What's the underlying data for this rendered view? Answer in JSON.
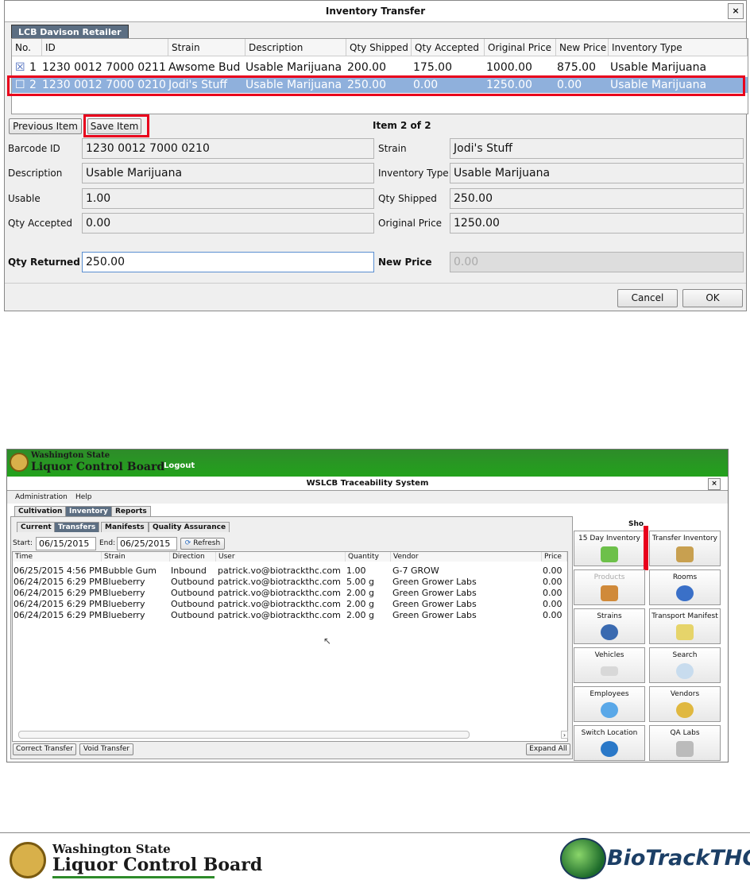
{
  "dialog": {
    "title": "Inventory Transfer",
    "close": "×",
    "tab": "LCB Davison Retailer",
    "columns": [
      "No.",
      "ID",
      "Strain",
      "Description",
      "Qty Shipped",
      "Qty Accepted",
      "Original Price",
      "New Price",
      "Inventory Type"
    ],
    "rows": [
      {
        "check": "☒",
        "no": "1",
        "id": "1230 0012 7000 0211",
        "strain": "Awsome Bud",
        "description": "Usable Marijuana",
        "qty_shipped": "200.00",
        "qty_accepted": "175.00",
        "original_price": "1000.00",
        "new_price": "875.00",
        "inventory_type": "Usable Marijuana"
      },
      {
        "check": "☐",
        "no": "2",
        "id": "1230 0012 7000 0210",
        "strain": "Jodi's Stuff",
        "description": "Usable Marijuana",
        "qty_shipped": "250.00",
        "qty_accepted": "0.00",
        "original_price": "1250.00",
        "new_price": "0.00",
        "inventory_type": "Usable Marijuana"
      }
    ],
    "prev_button": "Previous Item",
    "save_button": "Save Item",
    "item_counter": "Item 2 of 2",
    "fields": {
      "barcode_label": "Barcode ID",
      "barcode_value": "1230 0012 7000 0210",
      "strain_label": "Strain",
      "strain_value": "Jodi's Stuff",
      "description_label": "Description",
      "description_value": "Usable Marijuana",
      "inventory_type_label": "Inventory Type",
      "inventory_type_value": "Usable Marijuana",
      "usable_label": "Usable",
      "usable_value": "1.00",
      "qty_shipped_label": "Qty Shipped",
      "qty_shipped_value": "250.00",
      "qty_accepted_label": "Qty Accepted",
      "qty_accepted_value": "0.00",
      "original_price_label": "Original Price",
      "original_price_value": "1250.00",
      "qty_returned_label": "Qty Returned",
      "qty_returned_value": "250.00",
      "new_price_label": "New Price",
      "new_price_value": "0.00"
    },
    "cancel": "Cancel",
    "ok": "OK"
  },
  "app": {
    "logo_line1": "Washington State",
    "logo_line2": "Liquor Control Board",
    "logout": "Logout",
    "window_title": "WSLCB Traceability System",
    "close": "×",
    "menu": [
      "Administration",
      "Help"
    ],
    "main_tabs": [
      "Cultivation",
      "Inventory",
      "Reports"
    ],
    "sub_tabs": [
      "Current",
      "Transfers",
      "Manifests",
      "Quality Assurance"
    ],
    "start_label": "Start:",
    "start_value": "06/15/2015",
    "end_label": "End:",
    "end_value": "06/25/2015",
    "refresh": "Refresh",
    "columns": [
      "Time",
      "Strain",
      "Direction",
      "User",
      "Quantity",
      "Vendor",
      "Price"
    ],
    "rows": [
      {
        "time": "06/25/2015 4:56 PM",
        "strain": "Bubble Gum",
        "direction": "Inbound",
        "user": "patrick.vo@biotrackthc.com",
        "quantity": "1.00",
        "vendor": "G-7 GROW",
        "price": "0.00"
      },
      {
        "time": "06/24/2015 6:29 PM",
        "strain": "Blueberry",
        "direction": "Outbound",
        "user": "patrick.vo@biotrackthc.com",
        "quantity": "5.00 g",
        "vendor": "Green Grower Labs",
        "price": "0.00"
      },
      {
        "time": "06/24/2015 6:29 PM",
        "strain": "Blueberry",
        "direction": "Outbound",
        "user": "patrick.vo@biotrackthc.com",
        "quantity": "2.00 g",
        "vendor": "Green Grower Labs",
        "price": "0.00"
      },
      {
        "time": "06/24/2015 6:29 PM",
        "strain": "Blueberry",
        "direction": "Outbound",
        "user": "patrick.vo@biotrackthc.com",
        "quantity": "2.00 g",
        "vendor": "Green Grower Labs",
        "price": "0.00"
      },
      {
        "time": "06/24/2015 6:29 PM",
        "strain": "Blueberry",
        "direction": "Outbound",
        "user": "patrick.vo@biotrackthc.com",
        "quantity": "2.00 g",
        "vendor": "Green Grower Labs",
        "price": "0.00"
      }
    ],
    "correct_transfer": "Correct Transfer",
    "void_transfer": "Void Transfer",
    "expand_all": "Expand All",
    "shortcuts_label": "Sho",
    "tiles": [
      "15 Day Inventory",
      "Transfer Inventory",
      "Products",
      "Rooms",
      "Strains",
      "Transport Manifest",
      "Vehicles",
      "Search",
      "Employees",
      "Vendors",
      "Switch Location",
      "QA Labs"
    ]
  },
  "footer": {
    "lcb_line1": "Washington State",
    "lcb_line2": "Liquor Control Board",
    "biotrack": "BioTrackTHC"
  },
  "colors": {
    "highlight": "#e8001c",
    "selected_row": "#8fb0dc",
    "banner_green": "#2e8b2a",
    "tab_active": "#5c6e82"
  }
}
